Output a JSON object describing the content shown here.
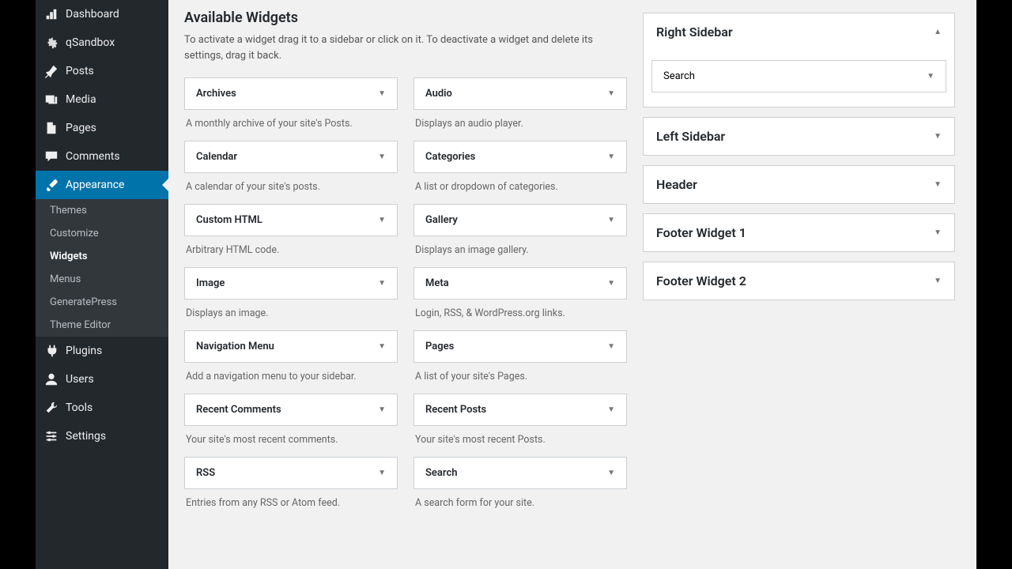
{
  "nav": {
    "dashboard": "Dashboard",
    "qsandbox": "qSandbox",
    "posts": "Posts",
    "media": "Media",
    "pages": "Pages",
    "comments": "Comments",
    "appearance": "Appearance",
    "plugins": "Plugins",
    "users": "Users",
    "tools": "Tools",
    "settings": "Settings"
  },
  "subnav": {
    "themes": "Themes",
    "customize": "Customize",
    "widgets": "Widgets",
    "menus": "Menus",
    "generatepress": "GeneratePress",
    "theme_editor": "Theme Editor"
  },
  "main": {
    "title": "Available Widgets",
    "desc": "To activate a widget drag it to a sidebar or click on it. To deactivate a widget and delete its settings, drag it back."
  },
  "widgets": [
    {
      "name": "Archives",
      "desc": "A monthly archive of your site's Posts."
    },
    {
      "name": "Audio",
      "desc": "Displays an audio player."
    },
    {
      "name": "Calendar",
      "desc": "A calendar of your site's posts."
    },
    {
      "name": "Categories",
      "desc": "A list or dropdown of categories."
    },
    {
      "name": "Custom HTML",
      "desc": "Arbitrary HTML code."
    },
    {
      "name": "Gallery",
      "desc": "Displays an image gallery."
    },
    {
      "name": "Image",
      "desc": "Displays an image."
    },
    {
      "name": "Meta",
      "desc": "Login, RSS, & WordPress.org links."
    },
    {
      "name": "Navigation Menu",
      "desc": "Add a navigation menu to your sidebar."
    },
    {
      "name": "Pages",
      "desc": "A list of your site's Pages."
    },
    {
      "name": "Recent Comments",
      "desc": "Your site's most recent comments."
    },
    {
      "name": "Recent Posts",
      "desc": "Your site's most recent Posts."
    },
    {
      "name": "RSS",
      "desc": "Entries from any RSS or Atom feed."
    },
    {
      "name": "Search",
      "desc": "A search form for your site."
    }
  ],
  "areas": {
    "right_sidebar": "Right Sidebar",
    "right_widget": "Search",
    "left_sidebar": "Left Sidebar",
    "header": "Header",
    "footer1": "Footer Widget 1",
    "footer2": "Footer Widget 2"
  }
}
